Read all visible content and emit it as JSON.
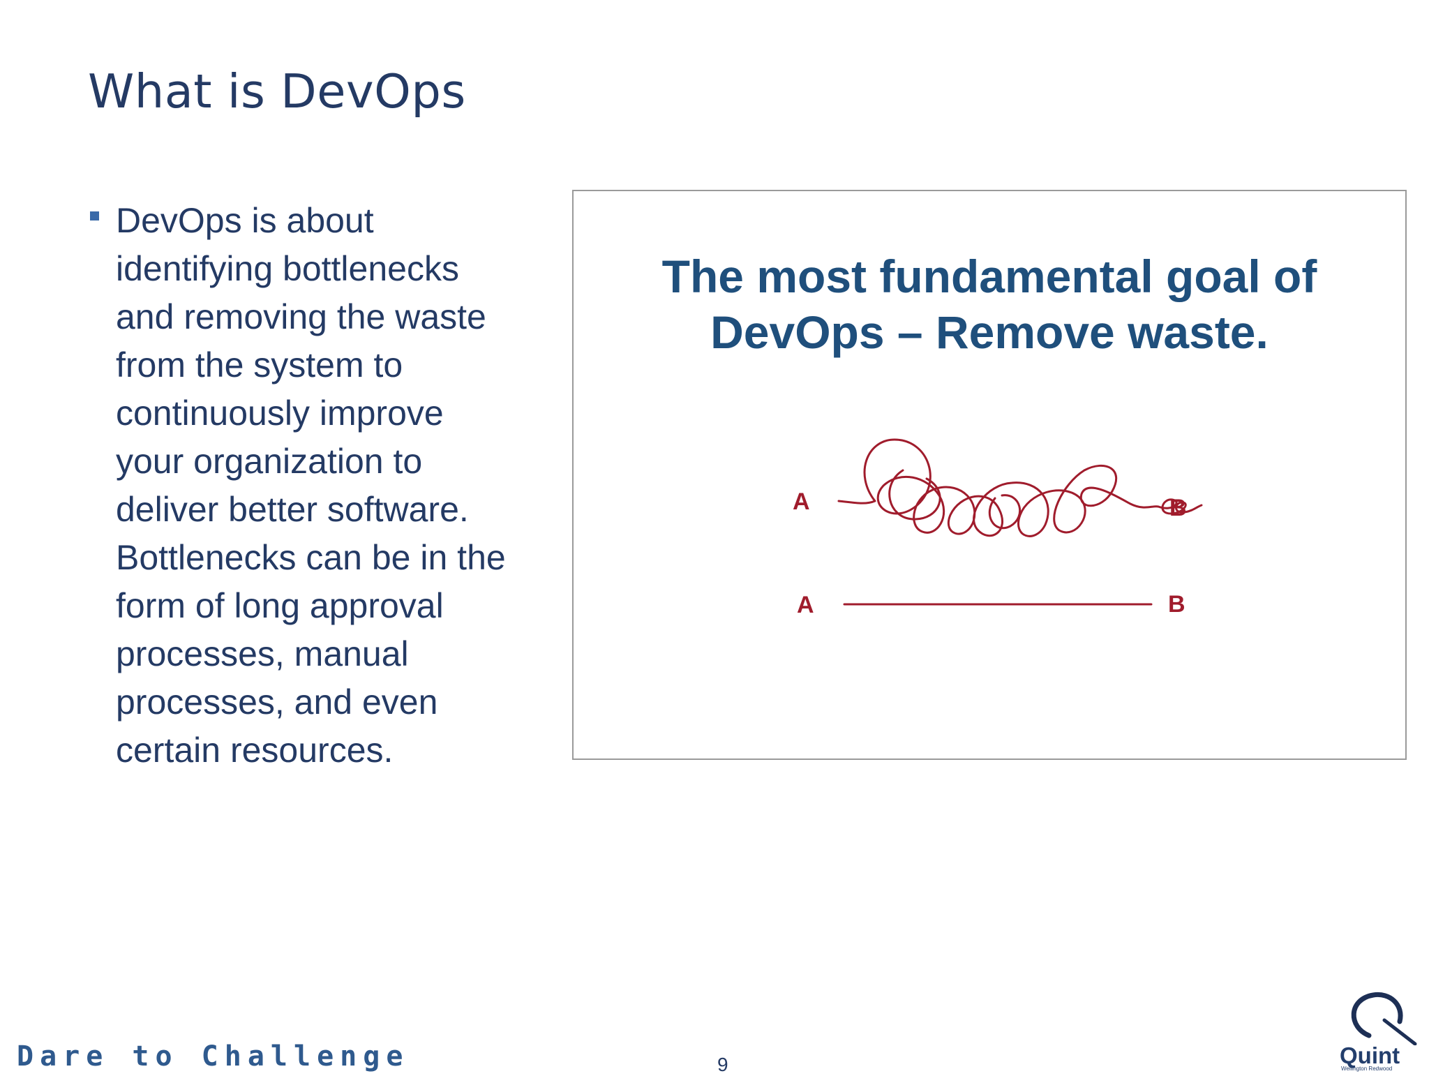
{
  "slide": {
    "title": "What is DevOps",
    "bullets": [
      "DevOps is about identifying bottlenecks and removing the waste from the system to continuously improve your organization to deliver better software. Bottlenecks can be in the form of long approval processes, manual processes, and even certain resources."
    ]
  },
  "figure": {
    "headline_line1": "The most fundamental goal of",
    "headline_line2": "DevOps – Remove waste.",
    "tangled_path": {
      "start_label": "A",
      "end_label": "B"
    },
    "straight_path": {
      "start_label": "A",
      "end_label": "B"
    },
    "line_color": "#a01c2c",
    "label_color": "#a01c2c"
  },
  "footer": {
    "tagline": "Dare to Challenge",
    "page_number": "9",
    "logo": {
      "name": "Quint",
      "subtitle": "Wellington Redwood"
    }
  },
  "colors": {
    "title": "#243a64",
    "bullet_marker": "#3a6aa8",
    "headline": "#1f4f7c",
    "tagline": "#2f5a8e"
  }
}
